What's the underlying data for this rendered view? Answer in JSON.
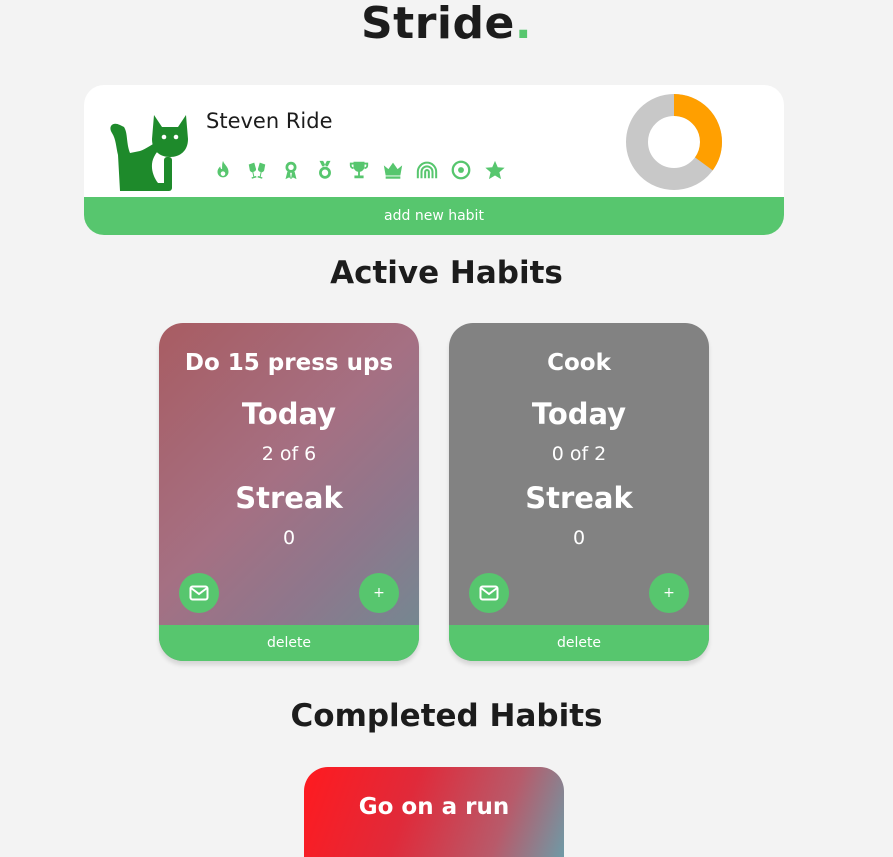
{
  "app": {
    "logo_text": "Stride",
    "logo_dot": "."
  },
  "profile": {
    "username": "Steven Ride",
    "avatar_icon": "cat-icon",
    "badges": [
      "flame-icon",
      "cheers-icon",
      "ribbon-icon",
      "medal-icon",
      "trophy-icon",
      "crown-icon",
      "rainbow-icon",
      "target-icon",
      "star-icon"
    ],
    "progress_fraction": 0.35,
    "add_habit_label": "add new habit"
  },
  "sections": {
    "active_title": "Active Habits",
    "completed_title": "Completed Habits"
  },
  "active_habits": [
    {
      "name": "Do 15 press ups",
      "today_label": "Today",
      "today_value": "2 of 6",
      "streak_label": "Streak",
      "streak_value": "0",
      "add_label": "+",
      "delete_label": "delete"
    },
    {
      "name": "Cook",
      "today_label": "Today",
      "today_value": "0 of 2",
      "streak_label": "Streak",
      "streak_value": "0",
      "add_label": "+",
      "delete_label": "delete"
    }
  ],
  "completed_habits": [
    {
      "name": "Go on a run"
    }
  ],
  "colors": {
    "accent": "#57c66e",
    "donut_fill": "#ff9f00",
    "donut_track": "#c8c8c8",
    "avatar": "#1e8a2b"
  }
}
